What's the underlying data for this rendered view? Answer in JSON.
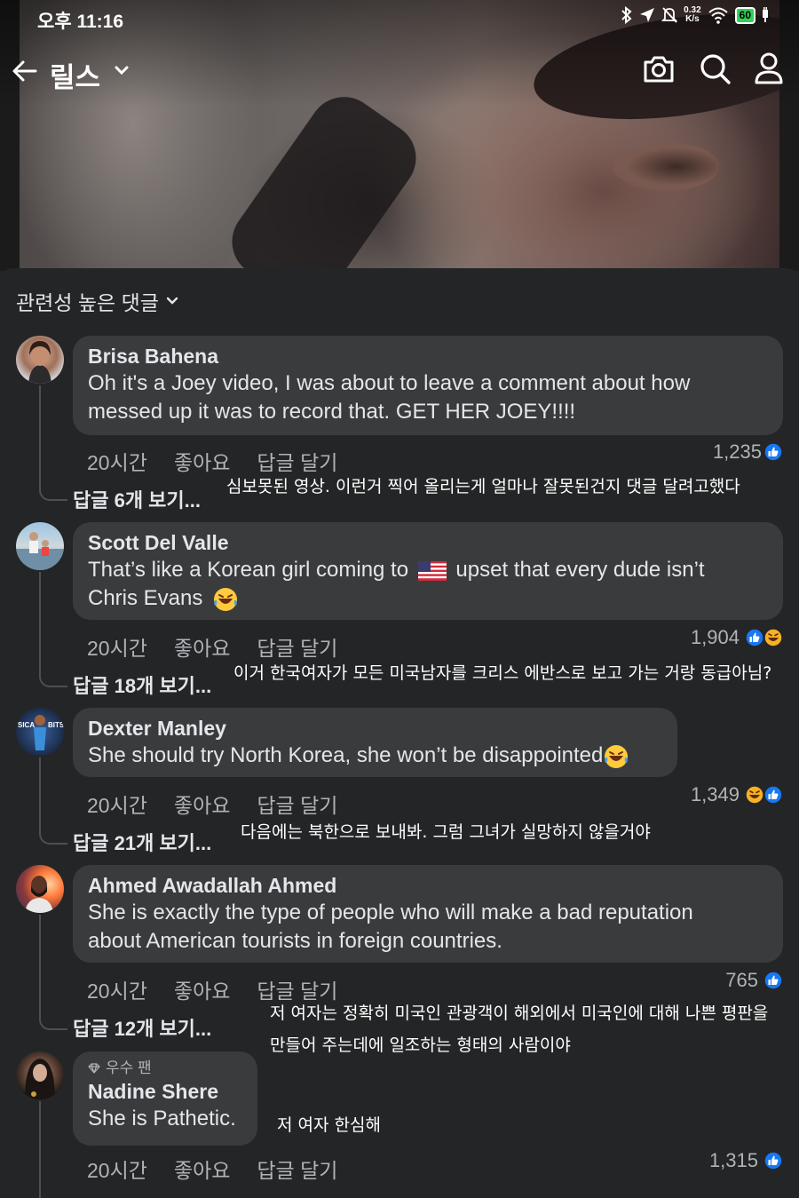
{
  "status_bar": {
    "time": "오후 11:16",
    "speed_value": "0.32",
    "speed_unit": "K/s",
    "battery": "60"
  },
  "header": {
    "title": "릴스"
  },
  "comments_section": {
    "sort_label": "관련성 높은 댓글"
  },
  "comments": [
    {
      "name": "Brisa Bahena",
      "text_lines": [
        "Oh it's a Joey video, I was about to leave a comment about how",
        "messed up it was to record that.  GET HER JOEY!!!!"
      ],
      "time": "20시간",
      "like_label": "좋아요",
      "reply_label": "답글 달기",
      "reaction_count": "1,235",
      "reactions": [
        "like"
      ],
      "view_replies": "답글 6개 보기...",
      "translation": [
        "심보못된 영상. 이런거 찍어 올리는게 얼마나 잘못된건지 댓글 달려고했다"
      ]
    },
    {
      "name": "Scott Del Valle",
      "text_parts": [
        "That’s like a Korean girl coming to",
        "upset that every dude isn’t",
        "Chris Evans"
      ],
      "time": "20시간",
      "like_label": "좋아요",
      "reply_label": "답글 달기",
      "reaction_count": "1,904",
      "reactions": [
        "like",
        "haha"
      ],
      "view_replies": "답글 18개 보기...",
      "translation": [
        "이거 한국여자가 모든 미국남자를 크리스 에반스로 보고 가는 거랑 동급아님?"
      ]
    },
    {
      "name": "Dexter Manley",
      "text_lines": [
        "She should try North Korea, she won’t be disappointed"
      ],
      "time": "20시간",
      "like_label": "좋아요",
      "reply_label": "답글 달기",
      "reaction_count": "1,349",
      "reactions": [
        "haha",
        "like"
      ],
      "view_replies": "답글 21개 보기...",
      "translation": [
        "다음에는 북한으로 보내봐. 그럼 그녀가 실망하지 않을거야"
      ]
    },
    {
      "name": "Ahmed Awadallah Ahmed",
      "text_lines": [
        "She is exactly the type of people who will make a bad reputation",
        "about American tourists in foreign countries."
      ],
      "time": "20시간",
      "like_label": "좋아요",
      "reply_label": "답글 달기",
      "reaction_count": "765",
      "reactions": [
        "like"
      ],
      "view_replies": "답글 12개 보기...",
      "translation": [
        "저 여자는 정확히 미국인 관광객이 해외에서 미국인에 대해 나쁜 평판을",
        "만들어 주는데에 일조하는 형태의 사람이야"
      ]
    },
    {
      "badge": "우수 팬",
      "name": "Nadine Shere",
      "text_lines": [
        "She is Pathetic."
      ],
      "time": "20시간",
      "like_label": "좋아요",
      "reply_label": "답글 달기",
      "reaction_count": "1,315",
      "reactions": [
        "like"
      ],
      "translation": [
        "저 여자 한심해"
      ]
    }
  ],
  "colors": {
    "panel_bg": "#242526",
    "bubble_bg": "#3a3b3c",
    "like_blue": "#1877f2",
    "haha_yellow": "#f7b125",
    "muted_text": "#b0b3b8"
  }
}
